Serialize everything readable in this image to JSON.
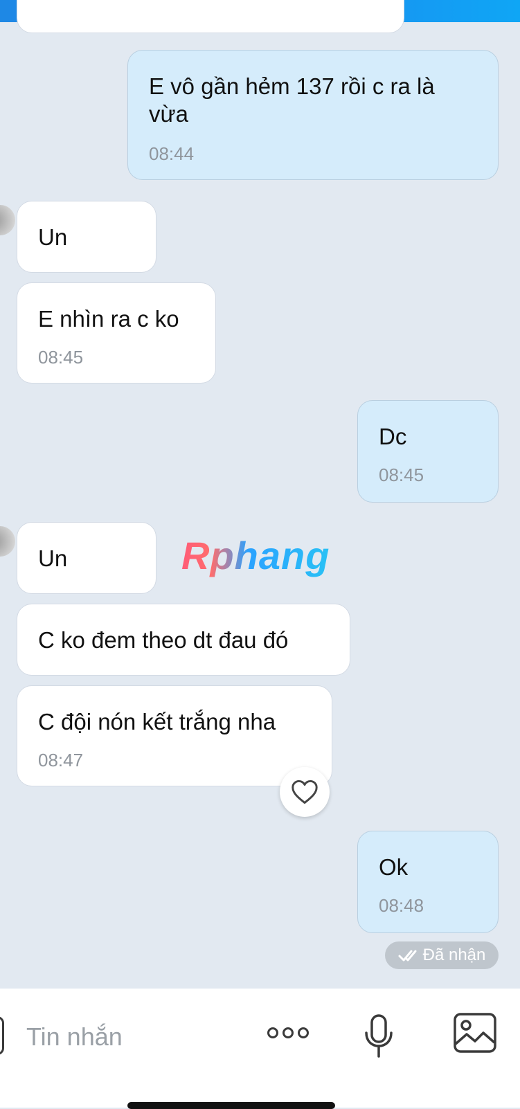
{
  "messages": [
    {
      "dir": "out",
      "text_lines": [
        "E vô gần hẻm 137 rồi c ra là",
        "vừa"
      ],
      "time": "08:44"
    },
    {
      "dir": "in",
      "text": "Un"
    },
    {
      "dir": "in",
      "text": "E nhìn ra c ko",
      "time": "08:45"
    },
    {
      "dir": "out",
      "text": "Dc",
      "time": "08:45"
    },
    {
      "dir": "in",
      "text": "Un"
    },
    {
      "dir": "in",
      "text": "C ko đem theo dt đau đó"
    },
    {
      "dir": "in",
      "text": "C đội nón kết trắng nha",
      "time": "08:47"
    },
    {
      "dir": "out",
      "text": "Ok",
      "time": "08:48"
    }
  ],
  "watermark": "Rphang",
  "status": {
    "received_label": "Đã nhận"
  },
  "reaction": {
    "icon": "heart-icon"
  },
  "composer": {
    "placeholder": "Tin nhắn",
    "icons": [
      "more-dots-icon",
      "microphone-icon",
      "image-icon"
    ]
  },
  "colors": {
    "incoming": "#ffffff",
    "outgoing": "#d5ecfb",
    "background": "#e2e9f1",
    "header": "#1e88e5"
  }
}
